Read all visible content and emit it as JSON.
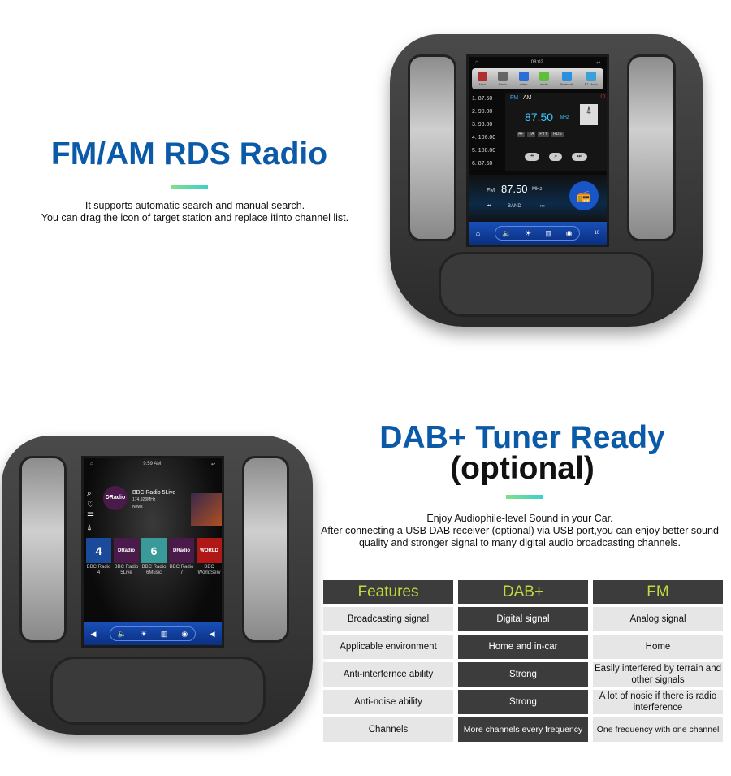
{
  "section1": {
    "title": "FM/AM RDS Radio",
    "desc_lines": [
      "It supports automatic search and manual search.",
      "You can drag the icon of target station and replace itinto channel list."
    ]
  },
  "radio_screen": {
    "time": "08:02",
    "apps": [
      {
        "label": "Navi",
        "color": "#b03030"
      },
      {
        "label": "Radio",
        "color": "#666666"
      },
      {
        "label": "video",
        "color": "#2a6fd8"
      },
      {
        "label": "audio",
        "color": "#5fbf3a"
      },
      {
        "label": "Bluetooth",
        "color": "#2a8fe0"
      },
      {
        "label": "BT Music",
        "color": "#3aa0d8"
      }
    ],
    "channels": [
      "1.  87.50",
      "2.  90.00",
      "3.  98.00",
      "4.  106.00",
      "5.  108.00",
      "6.  87.50"
    ],
    "bands": [
      "FM",
      "AM"
    ],
    "frequency": "87.50",
    "freq_unit": "MHZ",
    "rds_buttons": [
      "AF",
      "TA",
      "PTY",
      "RDS"
    ],
    "bottom_band": "FM",
    "bottom_freq": "87.50",
    "bottom_unit": "MHz",
    "band_label": "BAND",
    "volume": "10"
  },
  "section2": {
    "title": "DAB+ Tuner Ready",
    "subtitle": "(optional)",
    "desc_lines": [
      "Enjoy Audiophile-level Sound in your Car.",
      "After connecting a USB DAB receiver (optional) via USB port,you can enjoy better sound",
      "quality and stronger signal to many digital audio broadcasting channels."
    ]
  },
  "dab_screen": {
    "time": "9:59 AM",
    "station": "BBC Radio 5Live",
    "station_freq": "174.928MHz",
    "station_genre": "News",
    "logo_text": "DRadio",
    "tiles": [
      {
        "label": "BBC Radio 4",
        "text": "4",
        "color": "#1a4a9a"
      },
      {
        "label": "BBC Radio 5Live",
        "text": "DRadio",
        "color": "#4a1a4a"
      },
      {
        "label": "BBC Radio 6Music",
        "text": "6",
        "color": "#3a9a9a"
      },
      {
        "label": "BBC Radio 7",
        "text": "DRadio",
        "color": "#4a1a4a"
      },
      {
        "label": "BBC WorldServ",
        "text": "WORLD",
        "color": "#b01818"
      }
    ]
  },
  "table": {
    "headers": [
      "Features",
      "DAB+",
      "FM"
    ],
    "rows": [
      [
        "Broadcasting signal",
        "Digital signal",
        "Analog signal"
      ],
      [
        "Applicable environment",
        "Home and in-car",
        "Home"
      ],
      [
        "Anti-interfernce ability",
        "Strong",
        "Easily interfered by terrain and other signals"
      ],
      [
        "Anti-noise ability",
        "Strong",
        "A lot of nosie if there is radio interference"
      ],
      [
        "Channels",
        "More channels every frequency",
        "One frequency with one channel"
      ]
    ]
  }
}
